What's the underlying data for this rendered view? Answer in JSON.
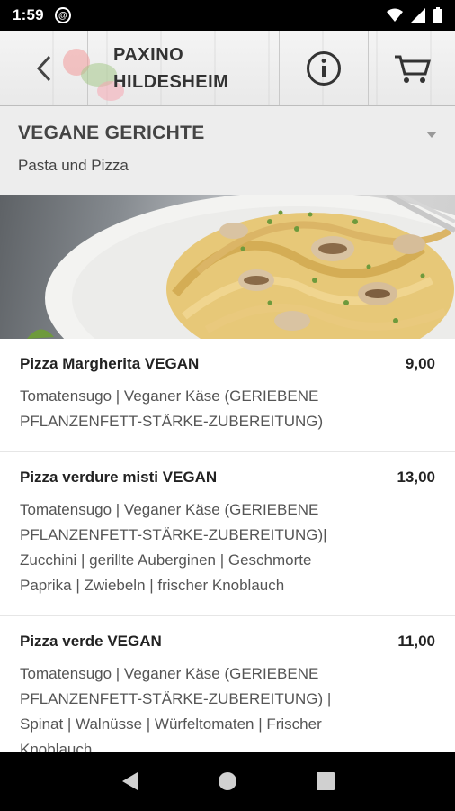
{
  "status_bar": {
    "time": "1:59",
    "badge_icon": "at-icon"
  },
  "app_bar": {
    "back_icon": "chevron-left-icon",
    "title_line1": "PAXINO",
    "title_line2": "HILDESHEIM",
    "info_icon": "info-circle-icon",
    "cart_icon": "cart-icon"
  },
  "category": {
    "title": "VEGANE GERICHTE",
    "subtitle": "Pasta und Pizza"
  },
  "menu_items": [
    {
      "name": "Pizza Margherita VEGAN",
      "price": "9,00",
      "description_lines": [
        "Tomatensugo | Veganer Käse (GERIEBENE",
        "PFLANZENFETT-STÄRKE-ZUBEREITUNG)"
      ]
    },
    {
      "name": "Pizza verdure misti VEGAN",
      "price": "13,00",
      "description_lines": [
        "Tomatensugo | Veganer Käse (GERIEBENE",
        "PFLANZENFETT-STÄRKE-ZUBEREITUNG)|",
        "Zucchini | gerillte Auberginen | Geschmorte",
        "Paprika | Zwiebeln | frischer Knoblauch"
      ]
    },
    {
      "name": "Pizza verde VEGAN",
      "price": "11,00",
      "description_lines": [
        "Tomatensugo | Veganer Käse (GERIEBENE",
        "PFLANZENFETT-STÄRKE-ZUBEREITUNG) |",
        "Spinat | Walnüsse | Würfeltomaten | Frischer",
        "Knoblauch"
      ]
    }
  ],
  "colors": {
    "status_bar_bg": "#000000",
    "section_bg": "#ededed",
    "text_dark": "#222222"
  }
}
